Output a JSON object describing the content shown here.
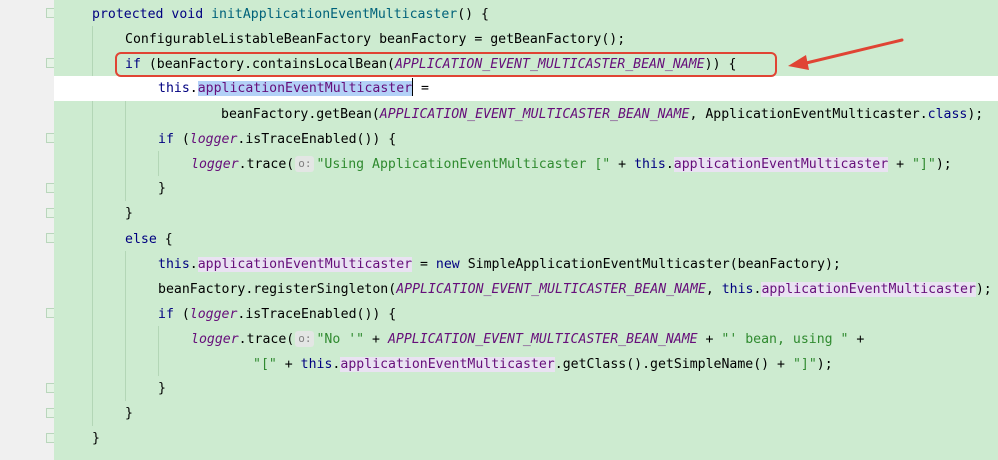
{
  "colors": {
    "background": "#cdebd0",
    "keyword": "#000080",
    "field": "#660e7a",
    "string": "#2f8a2f",
    "annotation_red": "#e04434"
  },
  "code": {
    "l1": {
      "a": "protected void ",
      "b": "initApplicationEventMulticaster",
      "c": "() {"
    },
    "l2": {
      "a": "ConfigurableListableBeanFactory beanFactory = getBeanFactory();"
    },
    "l3": {
      "kw": "if",
      "a": " (beanFactory.containsLocalBean(",
      "c": "APPLICATION_EVENT_MULTICASTER_BEAN_NAME",
      "b": ")) {"
    },
    "l4": {
      "kw": "this",
      "d": ".",
      "f": "applicationEventMulticaster",
      "a": " ="
    },
    "l5": {
      "a": "beanFactory.getBean(",
      "c": "APPLICATION_EVENT_MULTICASTER_BEAN_NAME",
      "b": ", ApplicationEventMulticaster.",
      "kw": "class",
      "e": ");"
    },
    "l6": {
      "kw": "if",
      "a": " (",
      "f": "logger",
      "b": ".isTraceEnabled()) {"
    },
    "l7": {
      "f": "logger",
      "a": ".trace(",
      "hint": "o:",
      "s": "\"Using ApplicationEventMulticaster [\"",
      "b": " + ",
      "kw": "this",
      "d": ".",
      "g": "applicationEventMulticaster",
      "e": " + ",
      "s2": "\"]\"",
      "z": ");"
    },
    "l8": {
      "a": "}"
    },
    "l9": {
      "a": "}"
    },
    "l10": {
      "kw": "else",
      "a": " {"
    },
    "l11": {
      "kw": "this",
      "d": ".",
      "g": "applicationEventMulticaster",
      "a": " = ",
      "kw2": "new",
      "b": " SimpleApplicationEventMulticaster(beanFactory);"
    },
    "l12": {
      "a": "beanFactory.registerSingleton(",
      "c": "APPLICATION_EVENT_MULTICASTER_BEAN_NAME",
      "b": ", ",
      "kw": "this",
      "d": ".",
      "g": "applicationEventMulticaster",
      "e": ");"
    },
    "l13": {
      "kw": "if",
      "a": " (",
      "f": "logger",
      "b": ".isTraceEnabled()) {"
    },
    "l14": {
      "f": "logger",
      "a": ".trace(",
      "hint": "o:",
      "s": "\"No '\"",
      "b": " + ",
      "c": "APPLICATION_EVENT_MULTICASTER_BEAN_NAME",
      "e": " + ",
      "s2": "\"' bean, using \"",
      "z": " +"
    },
    "l15": {
      "s": "\"[\"",
      "b": " + ",
      "kw": "this",
      "d": ".",
      "g": "applicationEventMulticaster",
      "e": ".getClass().getSimpleName() + ",
      "s2": "\"]\"",
      "z": ");"
    },
    "l16": {
      "a": "}"
    },
    "l17": {
      "a": "}"
    },
    "l18": {
      "a": "}"
    }
  }
}
